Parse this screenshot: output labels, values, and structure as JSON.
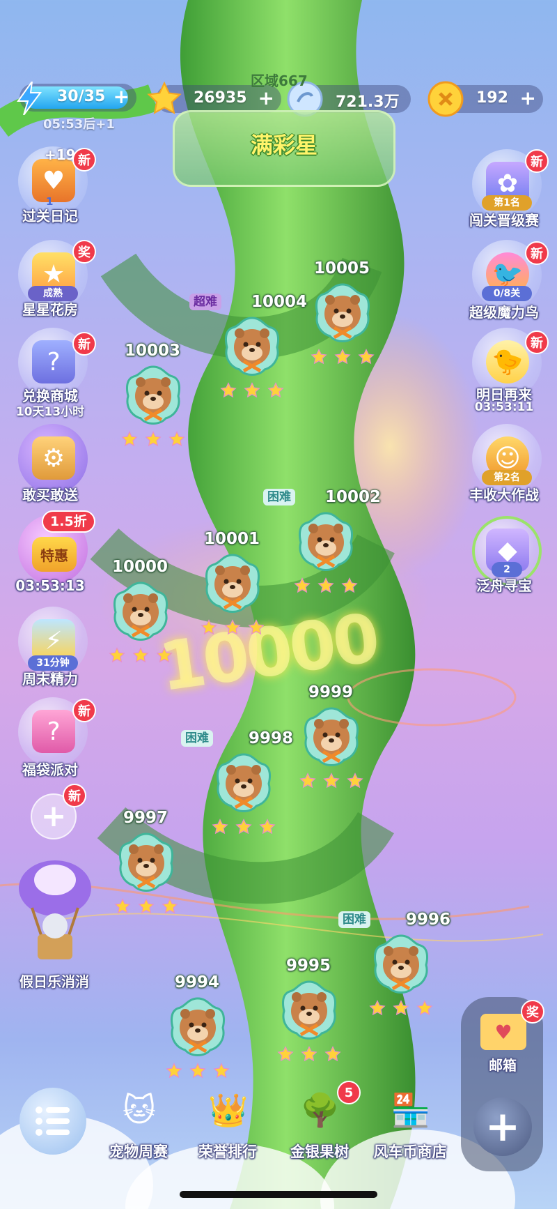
{
  "top_bar": {
    "energy": "30/35",
    "energy_timer": "05:53后+1",
    "stars": "26935",
    "coins": "721.3万",
    "gems": "192",
    "plus": "+"
  },
  "area": {
    "label": "区域667",
    "name": "满彩星"
  },
  "left_buttons": [
    {
      "label": "过关日记",
      "badge": "新",
      "tag": "1",
      "overlay": "+19"
    },
    {
      "label": "星星花房",
      "badge": "奖",
      "tag": "成熟"
    },
    {
      "label": "兑换商城",
      "badge": "新",
      "sub": "10天13小时"
    },
    {
      "label": "敢买敢送"
    },
    {
      "label": "03:53:13",
      "badge": "1.5折",
      "tag": "特惠"
    },
    {
      "label": "周末精力",
      "tag": "31分钟"
    },
    {
      "label": "福袋派对",
      "badge": "新"
    },
    {
      "badge": "新"
    },
    {
      "label": "假日乐消消"
    }
  ],
  "right_buttons": [
    {
      "label": "闯关晋级赛",
      "badge": "新",
      "tag": "第1名"
    },
    {
      "label": "超级魔力鸟",
      "badge": "新",
      "tag": "0/8关"
    },
    {
      "label": "明日再来",
      "badge": "新",
      "sub": "03:53:11"
    },
    {
      "label": "丰收大作战",
      "tag": "第2名"
    },
    {
      "label": "泛舟寻宝",
      "tag": "2"
    }
  ],
  "levels": [
    {
      "number": "10005",
      "difficulty": ""
    },
    {
      "number": "10004",
      "difficulty": "超难"
    },
    {
      "number": "10003",
      "difficulty": ""
    },
    {
      "number": "10002",
      "difficulty": "困难"
    },
    {
      "number": "10001",
      "difficulty": ""
    },
    {
      "number": "10000",
      "difficulty": ""
    },
    {
      "number": "9999",
      "difficulty": ""
    },
    {
      "number": "9998",
      "difficulty": "困难"
    },
    {
      "number": "9997",
      "difficulty": ""
    },
    {
      "number": "9996",
      "difficulty": "困难"
    },
    {
      "number": "9995",
      "difficulty": ""
    },
    {
      "number": "9994",
      "difficulty": ""
    }
  ],
  "milestone": "10000",
  "bottom_bar": {
    "items": [
      {
        "label": "宠物周赛"
      },
      {
        "label": "荣誉排行"
      },
      {
        "label": "金银果树",
        "badge": "5"
      },
      {
        "label": "风车币商店"
      }
    ],
    "mailbox": {
      "label": "邮箱",
      "badge": "奖"
    }
  },
  "colors": {
    "beanstalk": "#5fc84a",
    "badge_red": "#f03a4a",
    "hard_tag": "#2f8b8b",
    "super_hard_tag": "#6a2ca0",
    "star_gold": "#ffd23a"
  }
}
